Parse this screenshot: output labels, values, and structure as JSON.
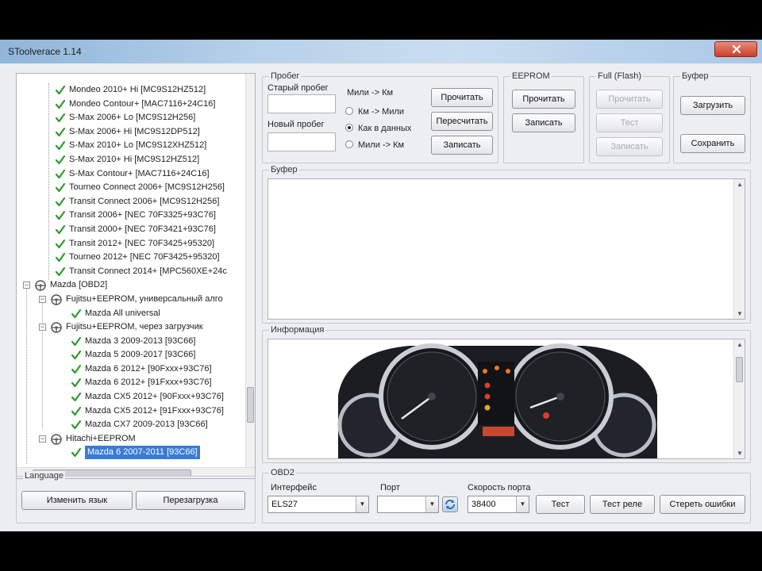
{
  "window": {
    "title": "SToolverace 1.14"
  },
  "tree": {
    "items": [
      {
        "label": "Mondeo 2010+ Hi [MC9S12HZ512]",
        "kind": "leaf",
        "level": 2
      },
      {
        "label": "Mondeo Contour+ [MAC7116+24C16]",
        "kind": "leaf",
        "level": 2
      },
      {
        "label": "S-Max 2006+ Lo [MC9S12H256]",
        "kind": "leaf",
        "level": 2
      },
      {
        "label": "S-Max 2006+ Hi [MC9S12DP512]",
        "kind": "leaf",
        "level": 2
      },
      {
        "label": "S-Max 2010+ Lo [MC9S12XHZ512]",
        "kind": "leaf",
        "level": 2
      },
      {
        "label": "S-Max 2010+ Hi [MC9S12HZ512]",
        "kind": "leaf",
        "level": 2
      },
      {
        "label": "S-Max Contour+ [MAC7116+24C16]",
        "kind": "leaf",
        "level": 2
      },
      {
        "label": "Tourneo Connect 2006+ [MC9S12H256]",
        "kind": "leaf",
        "level": 2
      },
      {
        "label": "Transit Connect 2006+ [MC9S12H256]",
        "kind": "leaf",
        "level": 2
      },
      {
        "label": "Transit 2006+ [NEC 70F3325+93C76]",
        "kind": "leaf",
        "level": 2
      },
      {
        "label": "Transit 2000+ [NEC 70F3421+93C76]",
        "kind": "leaf",
        "level": 2
      },
      {
        "label": "Transit 2012+ [NEC 70F3425+95320]",
        "kind": "leaf",
        "level": 2
      },
      {
        "label": "Tourneo 2012+ [NEC 70F3425+95320]",
        "kind": "leaf",
        "level": 2
      },
      {
        "label": "Transit Connect 2014+ [MPC560XE+24c",
        "kind": "leaf",
        "level": 2
      },
      {
        "label": "Mazda [OBD2]",
        "kind": "group",
        "level": 0
      },
      {
        "label": "Fujitsu+EEPROM, универсальный алго",
        "kind": "group",
        "level": 1
      },
      {
        "label": "Mazda All universal",
        "kind": "leaf",
        "level": 3
      },
      {
        "label": "Fujitsu+EEPROM, через загрузчик",
        "kind": "group",
        "level": 1
      },
      {
        "label": "Mazda 3 2009-2013 [93C66]",
        "kind": "leaf",
        "level": 3
      },
      {
        "label": "Mazda 5 2009-2017 [93C66]",
        "kind": "leaf",
        "level": 3
      },
      {
        "label": "Mazda 6 2012+ [90Fxxx+93C76]",
        "kind": "leaf",
        "level": 3
      },
      {
        "label": "Mazda 6 2012+ [91Fxxx+93C76]",
        "kind": "leaf",
        "level": 3
      },
      {
        "label": "Mazda CX5 2012+ [90Fxxx+93C76]",
        "kind": "leaf",
        "level": 3
      },
      {
        "label": "Mazda CX5 2012+ [91Fxxx+93C76]",
        "kind": "leaf",
        "level": 3
      },
      {
        "label": "Mazda CX7 2009-2013 [93C66]",
        "kind": "leaf",
        "level": 3
      },
      {
        "label": "Hitachi+EEPROM",
        "kind": "group",
        "level": 1
      },
      {
        "label": "Mazda 6 2007-2011 [93C66]",
        "kind": "leaf",
        "level": 3,
        "selected": true
      }
    ]
  },
  "language": {
    "title": "Language",
    "change_label": "Изменить язык",
    "check_label": "Перезагрузка"
  },
  "mileage": {
    "title": "Пробег",
    "old_label": "Старый пробег",
    "new_label": "Новый пробег",
    "radios": [
      {
        "label": "Мили -> Км",
        "selected": false
      },
      {
        "label": "Км -> Мили",
        "selected": false
      },
      {
        "label": "Как в данных",
        "selected": true
      },
      {
        "label": "Мили -> Км",
        "selected": false
      }
    ],
    "buttons": [
      "Прочитать",
      "Пересчитать",
      "Записать"
    ]
  },
  "eeprom": {
    "title": "EEPROM",
    "buttons": [
      "Прочитать",
      "Записать"
    ]
  },
  "flash": {
    "title": "Full (Flash)",
    "buttons": [
      "Прочитать",
      "Тест",
      "Записать"
    ]
  },
  "buffer_group": {
    "title": "Буфер",
    "buttons": [
      "Загрузить",
      "Сохранить"
    ]
  },
  "buffer_panel": {
    "title": "Буфер"
  },
  "info_panel": {
    "title": "Информация"
  },
  "obd2": {
    "title": "OBD2",
    "interface_label": "Интерфейс",
    "interface_value": "ELS27",
    "port_label": "Порт",
    "port_value": "",
    "speed_label": "Скорость порта",
    "speed_value": "38400",
    "buttons": [
      "Тест",
      "Тест реле",
      "Стереть ошибки"
    ]
  },
  "colors": {
    "selection": "#3a7bd5",
    "check": "#2e9a2e",
    "close_button": "#c9402a"
  }
}
